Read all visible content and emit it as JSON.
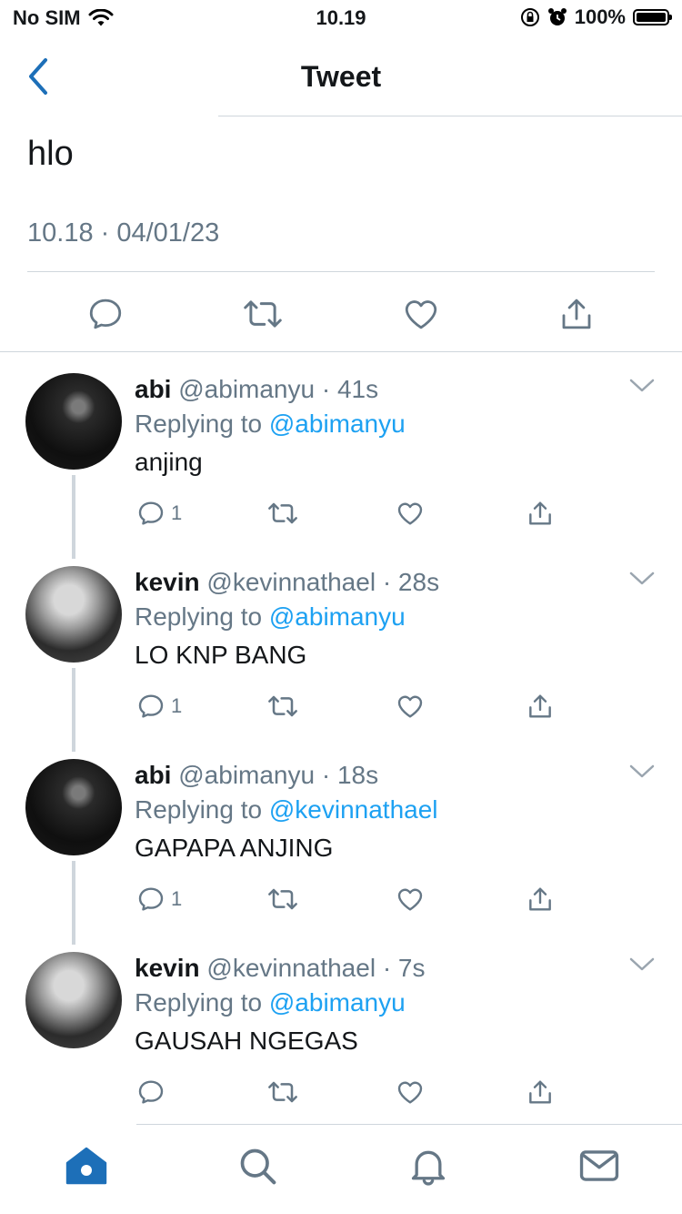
{
  "status_bar": {
    "carrier": "No SIM",
    "time": "10.19",
    "battery": "100%"
  },
  "nav": {
    "title": "Tweet"
  },
  "main_tweet": {
    "text": "hlo",
    "meta": "10.18 · 04/01/23"
  },
  "replies": [
    {
      "name": "abi",
      "handle": "@abimanyu · 41s",
      "replying_label": "Replying to",
      "replying_to": "@abimanyu",
      "text": "anjing",
      "reply_count": "1"
    },
    {
      "name": "kevin",
      "handle": "@kevinnathael · 28s",
      "replying_label": "Replying to",
      "replying_to": "@abimanyu",
      "text": "LO KNP BANG",
      "reply_count": "1"
    },
    {
      "name": "abi",
      "handle": "@abimanyu · 18s",
      "replying_label": "Replying to",
      "replying_to": "@kevinnathael",
      "text": "GAPAPA ANJING",
      "reply_count": "1"
    },
    {
      "name": "kevin",
      "handle": "@kevinnathael · 7s",
      "replying_label": "Replying to",
      "replying_to": "@abimanyu",
      "text": "GAUSAH NGEGAS",
      "reply_count": ""
    }
  ],
  "colors": {
    "accent": "#1da1f2",
    "secondary_text": "#657786",
    "divider": "#cfd6dc",
    "home_active": "#1d6fb8"
  },
  "icons": [
    "wifi-icon",
    "orientation-lock-icon",
    "alarm-icon",
    "battery-icon",
    "back-chevron-icon",
    "reply-icon",
    "retweet-icon",
    "like-icon",
    "share-icon",
    "chevron-down-icon",
    "home-icon",
    "search-icon",
    "notifications-icon",
    "messages-icon"
  ]
}
